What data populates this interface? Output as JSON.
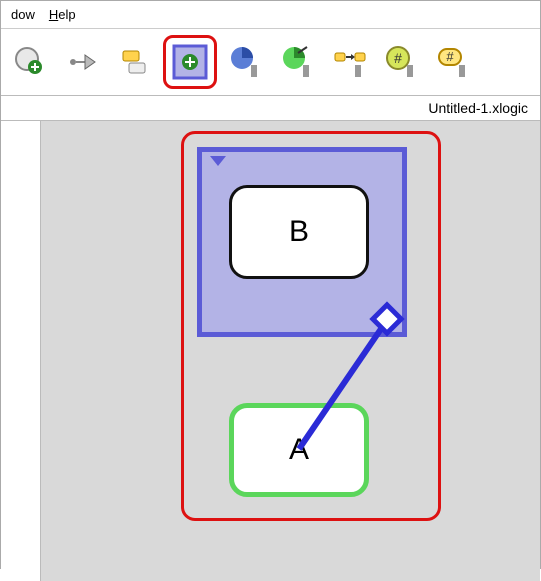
{
  "menu": {
    "item1": "dow",
    "item2": "Help"
  },
  "filename": "Untitled-1.xlogic",
  "nodes": {
    "b_label": "B",
    "a_label": "A"
  },
  "icons": {
    "i1": "add-circle-icon",
    "i2": "connector-icon",
    "i3": "window-stack-icon",
    "i4": "add-set-icon",
    "i5": "pie-icon",
    "i6": "pie-split-icon",
    "i7": "transform-icon",
    "i8": "hash-green-icon",
    "i9": "hash-yellow-icon"
  }
}
